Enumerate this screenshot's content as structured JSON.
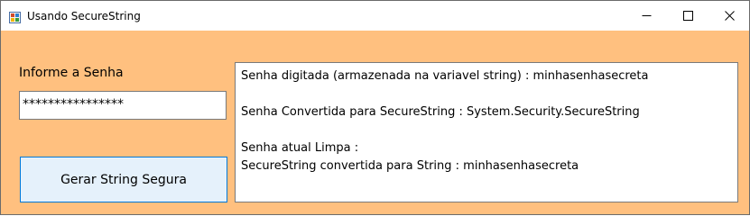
{
  "window": {
    "title": "Usando SecureString"
  },
  "form": {
    "password_label": "Informe a Senha",
    "password_value": "****************",
    "button_label": "Gerar String Segura"
  },
  "output": {
    "lines": [
      "Senha digitada (armazenada na variavel string) : minhasenhasecreta",
      "",
      "Senha Convertida para SecureString : System.Security.SecureString",
      "",
      "Senha atual Limpa :",
      "SecureString convertida para String : minhasenhasecreta"
    ]
  },
  "colors": {
    "form_background": "#ffc07f",
    "button_background": "#e5f1fb",
    "button_border": "#0078d7"
  },
  "icons": {
    "app": "app-icon",
    "minimize": "minimize-icon",
    "maximize": "maximize-icon",
    "close": "close-icon"
  }
}
